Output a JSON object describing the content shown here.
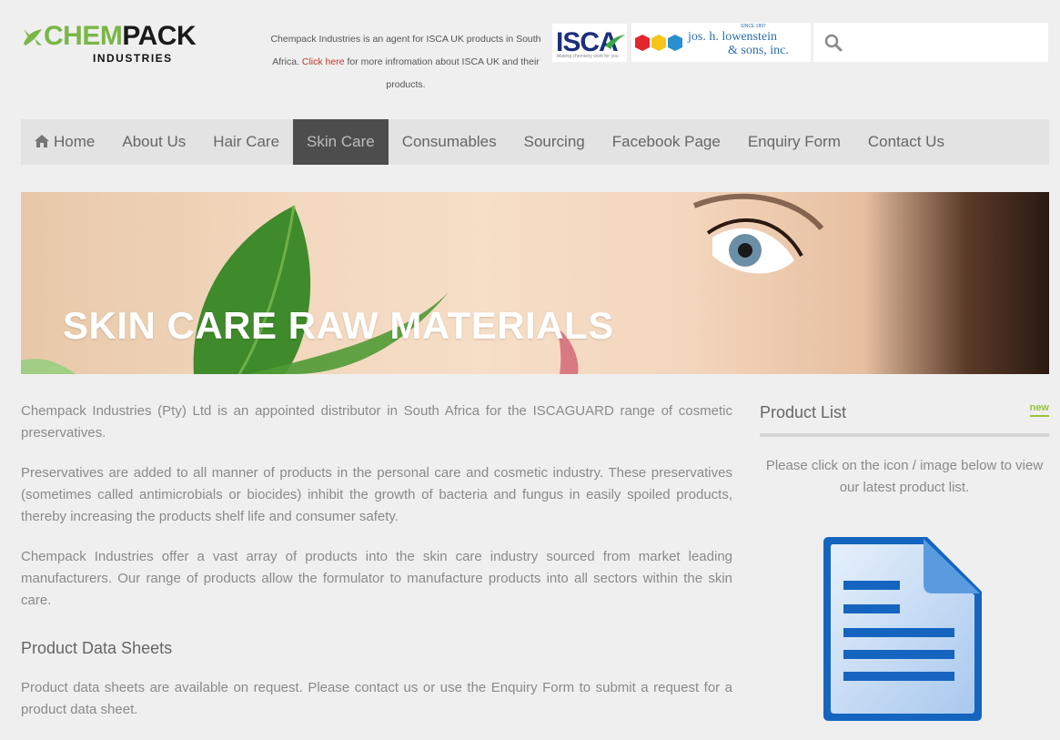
{
  "header": {
    "logo_main_left": "CHEM",
    "logo_main_right": "PACK",
    "logo_sub": "INDUSTRIES",
    "agent_text_before": "Chempack Industries is an agent for ISCA UK products in South Africa. ",
    "agent_link": "Click here",
    "agent_text_after": " for more infromation about ISCA UK and their products.",
    "isca_logo_text": "ISCA",
    "isca_tagline": "Making chemistry work for you",
    "lowenstein_since": "SINCE 1897",
    "lowenstein_line1": "jos. h. lowenstein",
    "lowenstein_line2": "& sons, inc.",
    "search_placeholder": ""
  },
  "nav": {
    "items": [
      {
        "label": "Home",
        "icon": "home-icon",
        "active": false
      },
      {
        "label": "About Us",
        "active": false
      },
      {
        "label": "Hair Care",
        "active": false
      },
      {
        "label": "Skin Care",
        "active": true
      },
      {
        "label": "Consumables",
        "active": false
      },
      {
        "label": "Sourcing",
        "active": false
      },
      {
        "label": "Facebook Page",
        "active": false
      },
      {
        "label": "Enquiry Form",
        "active": false
      },
      {
        "label": "Contact Us",
        "active": false
      }
    ]
  },
  "banner": {
    "title": "SKIN CARE RAW MATERIALS"
  },
  "content": {
    "p1": "Chempack Industries (Pty) Ltd is an appointed distributor in South Africa for the ISCAGUARD range of cosmetic preservatives.",
    "p2": "Preservatives are added to all manner of products in the personal care and cosmetic industry. These preservatives (sometimes called antimicrobials or biocides) inhibit the growth of bacteria and fungus in easily spoiled products, thereby increasing the products shelf life and consumer safety.",
    "p3": "Chempack Industries offer a vast array of products into the skin care industry sourced from market leading manufacturers. Our range of products allow the formulator to manufacture products into all sectors within the skin care.",
    "h_datasheets": "Product Data Sheets",
    "p4": "Product data sheets are available on request. Please contact us or use the Enquiry Form to submit a request for a product data sheet."
  },
  "sidebar": {
    "title": "Product List",
    "badge": "new",
    "text": "Please click on the icon / image below to view our latest product list.",
    "doc_icon": "document-icon"
  },
  "colors": {
    "brand_green": "#7ab648",
    "nav_active_bg": "#4d4d4d",
    "link_red": "#c0392b",
    "badge_green": "#9bc23c"
  }
}
